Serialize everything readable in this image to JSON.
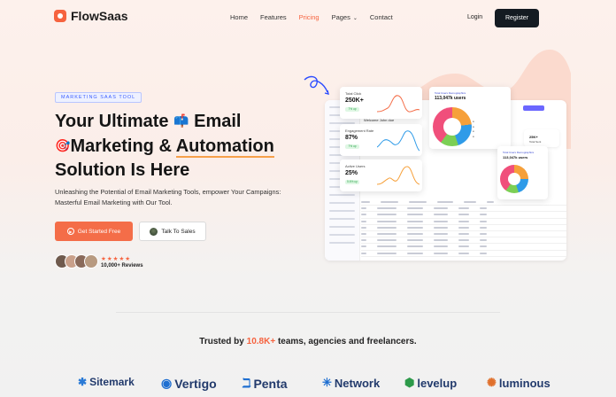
{
  "nav": {
    "brand": "FlowSaas",
    "items": [
      "Home",
      "Features",
      "Pricing",
      "Pages",
      "Contact"
    ],
    "active": "Pricing",
    "login": "Login",
    "register": "Register"
  },
  "hero": {
    "tag": "MARKETING SAAS TOOL",
    "title_1": "Your Ultimate",
    "title_2": "Email",
    "title_3": "Marketing &",
    "title_4": "Automation",
    "title_5": "Solution Is Here",
    "subtitle": "Unleashing the Potential of Email Marketing Tools, empower Your Campaigns: Masterful Email Marketing with Our Tool.",
    "cta_primary": "Get Started Free",
    "cta_secondary": "Talk To Sales",
    "stars": "★★★★★",
    "reviews": "10,000+ Reviews"
  },
  "dashboard": {
    "welcome": "Welcome John doe",
    "cards": [
      {
        "label": "Total Click",
        "value": "250K+",
        "chip": "7% up"
      },
      {
        "label": "Engagement Rate",
        "value": "87%",
        "chip": "7% up"
      },
      {
        "label": "Active Users",
        "value": "25%",
        "chip": "5.6% up"
      }
    ],
    "users_card": {
      "label": "Total Users Demographics",
      "value": "113,047k users"
    },
    "users_card_2": {
      "label": "Total Users Demographics",
      "value": "113,047k users"
    },
    "small_card": {
      "value": "25K+",
      "label": "Total Sent"
    }
  },
  "trust": {
    "prefix": "Trusted by",
    "highlight": "10.8K+",
    "suffix": "teams, agencies and freelancers."
  },
  "logos": [
    "Sitemark",
    "Vertigo",
    "Penta",
    "Network",
    "levelup",
    "luminous"
  ],
  "colors": {
    "accent": "#f6633f",
    "dark": "#141b22",
    "brand_logo": "#223a6c"
  }
}
